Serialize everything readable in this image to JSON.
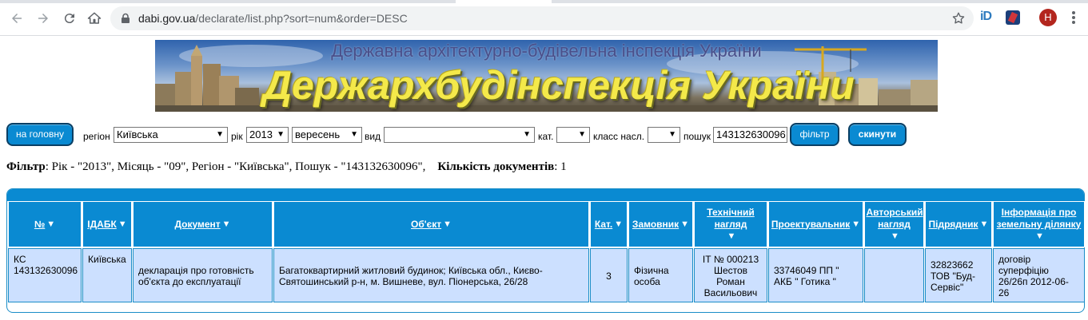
{
  "browser": {
    "url_host": "dabi.gov.ua",
    "url_path": "/declarate/list.php?sort=num&order=DESC",
    "extension_label": "iD",
    "profile_initial": "H"
  },
  "banner": {
    "subtitle": "Державна архітектурно-будівельна інспекція України",
    "title": "Держархбудінспекція України"
  },
  "filters": {
    "home_button": "на головну",
    "region_label": "регіон",
    "region_value": "Київська",
    "year_label": "рік",
    "year_value": "2013",
    "month_value": "вересень",
    "type_label": "вид",
    "type_value": "",
    "cat_label": "кат.",
    "cat_value": "",
    "class_label": "класс насл.",
    "class_value": "",
    "search_label": "пошук",
    "search_value": "143132630096",
    "filter_button": "фільтр",
    "reset_button": "скинути"
  },
  "summary": {
    "filter_label": "Фільтр",
    "filter_text": ": Рік - \"2013\", Місяць - \"09\", Регіон - \"Київська\", Пошук - \"143132630096\",",
    "count_label": "Кількість документів",
    "count_value": ": 1"
  },
  "table": {
    "headers": [
      "№",
      "ІДАБК",
      "Документ",
      "Об'єкт",
      "Кат.",
      "Замовник",
      "Технічний нагляд",
      "Проектувальник",
      "Авторський нагляд",
      "Підрядник",
      "Інформація про земельну ділянку"
    ],
    "sort_indicator": "▼",
    "rows": [
      {
        "num": "КС 143132630096",
        "idabk": "Київська",
        "document": "декларація про готовність об'єкта до експлуатації",
        "object": "Багатоквартирний житловий будинок; Київська обл., Києво-Святошинський р-н, м. Вишневе, вул. Піонерська, 26/28",
        "cat": "3",
        "customer": "Фізична особа",
        "tech_supervision": "ІТ № 000213 Шестов Роман Васильович",
        "designer": "33746049 ПП \" АКБ \" Готика \"",
        "author_supervision": "",
        "contractor": "32823662 ТОВ \"Буд-Сервіс\"",
        "land_info": "договір суперфіцію 26/26п 2012-06-26"
      }
    ]
  }
}
